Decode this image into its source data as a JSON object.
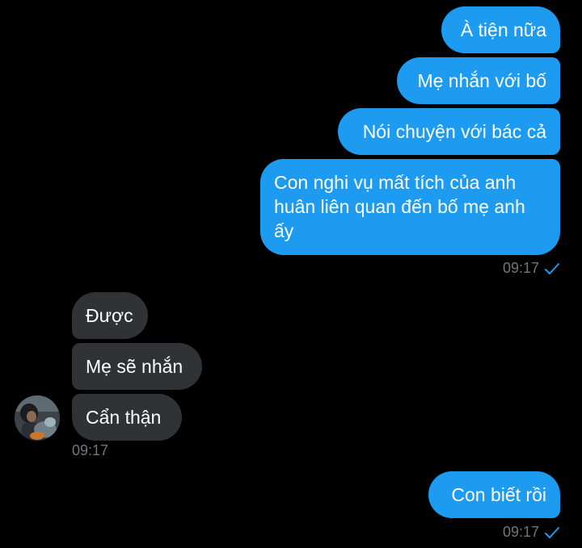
{
  "conversation": {
    "outgoing_group_1": [
      "À tiện nữa",
      "Mẹ nhắn với bố",
      "Nói chuyện với bác cả",
      "Con nghi vụ mất tích của anh huân liên quan đến bố mẹ anh ấy"
    ],
    "outgoing_group_1_time": "09:17",
    "incoming_group": [
      "Được",
      "Mẹ sẽ nhắn",
      "Cẩn thận"
    ],
    "incoming_group_time": "09:17",
    "outgoing_group_2": [
      "Con biết rồi"
    ],
    "outgoing_group_2_time": "09:17"
  },
  "icons": {
    "read_receipt": "check-icon",
    "contact_avatar": "avatar-photo"
  },
  "colors": {
    "background": "#000000",
    "outgoing_bubble": "#1d9bf0",
    "incoming_bubble": "#2f3336",
    "timestamp": "#71767b",
    "check": "#1d9bf0"
  }
}
